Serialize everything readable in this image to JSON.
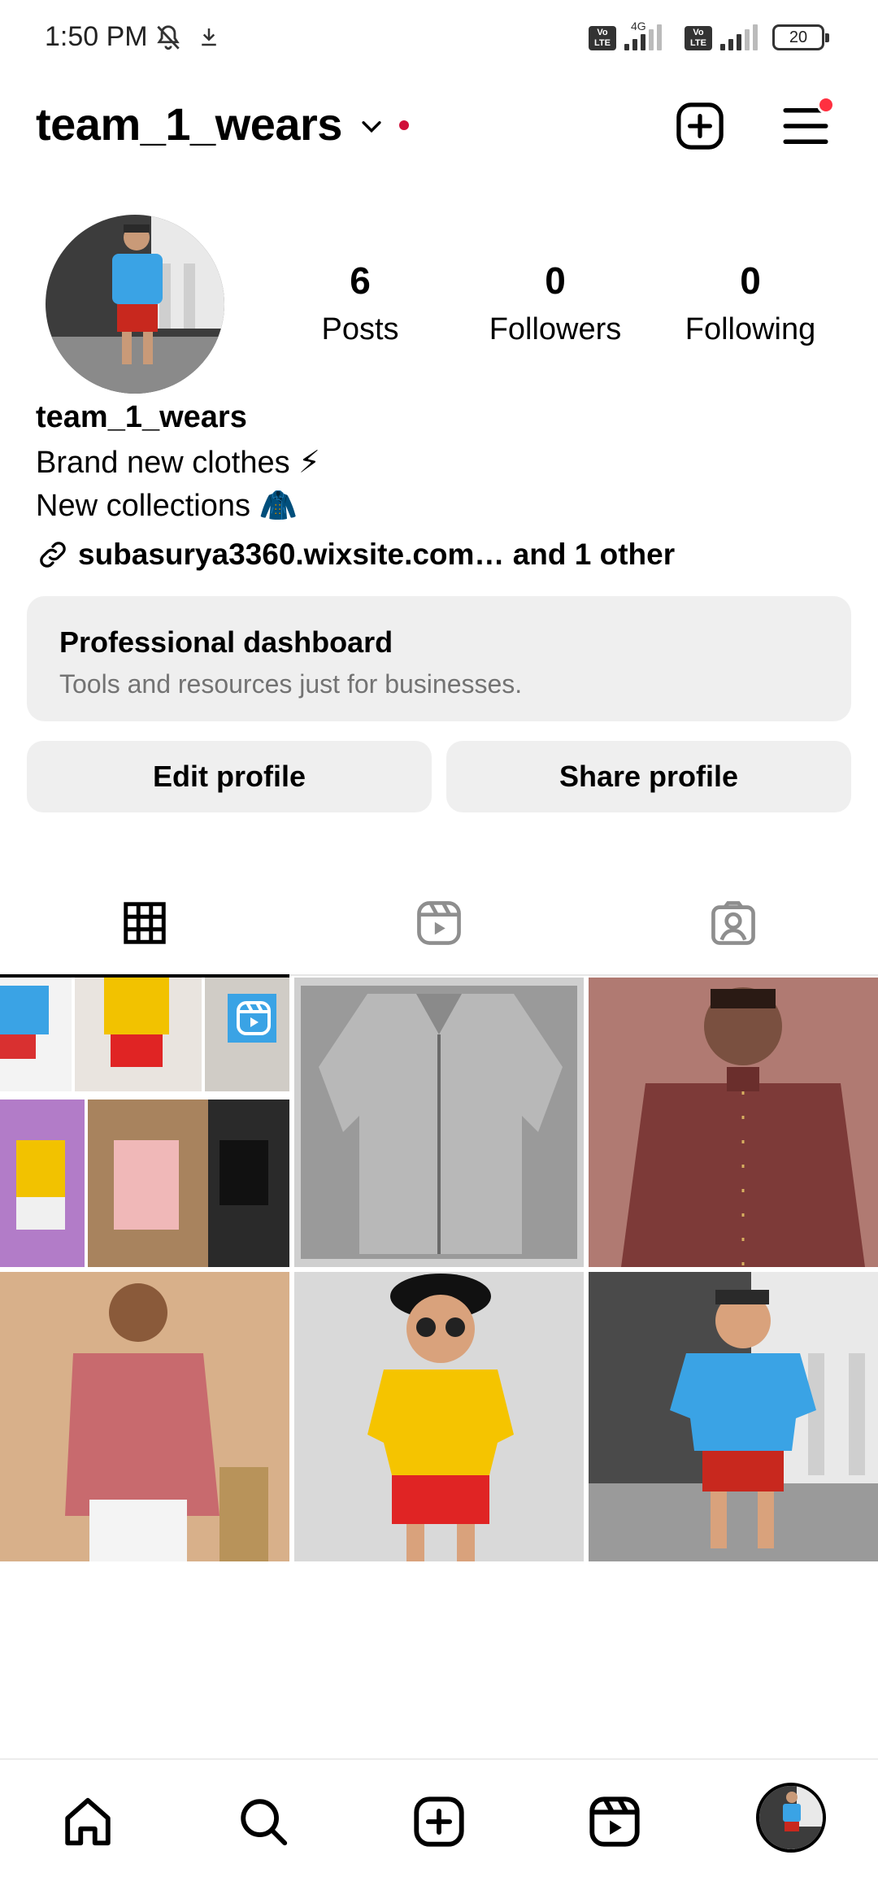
{
  "status_bar": {
    "time": "1:50 PM",
    "network_label": "4G",
    "volte_label": "Vo LTE",
    "battery": "20"
  },
  "header": {
    "username": "team_1_wears"
  },
  "profile": {
    "stats": [
      {
        "value": "6",
        "label": "Posts"
      },
      {
        "value": "0",
        "label": "Followers"
      },
      {
        "value": "0",
        "label": "Following"
      }
    ],
    "display_name": "team_1_wears",
    "bio_lines": [
      "Brand new clothes ⚡",
      "New collections 🧥"
    ],
    "link": "subasurya3360.wixsite.com… and 1 other"
  },
  "dashboard": {
    "title": "Professional dashboard",
    "subtitle": "Tools and resources just for businesses."
  },
  "buttons": {
    "edit_profile": "Edit profile",
    "share_profile": "Share profile"
  },
  "tabs": [
    "grid-tab",
    "reels-tab",
    "tagged-tab"
  ],
  "posts": [
    {
      "type": "collage-reel",
      "colors": [
        "#3a9fe0",
        "#f2c200",
        "#d93030"
      ]
    },
    {
      "type": "photo",
      "subject": "grey printed shirt",
      "colors": [
        "#9a9a9a",
        "#6a6a6a"
      ]
    },
    {
      "type": "photo",
      "subject": "maroon jodhpuri suit",
      "colors": [
        "#b07a72",
        "#7d3a38"
      ]
    },
    {
      "type": "photo",
      "subject": "pink jodhpuri suit",
      "colors": [
        "#d8b08a",
        "#c86a6e"
      ]
    },
    {
      "type": "photo",
      "subject": "kid yellow tshirt red shorts",
      "colors": [
        "#d9d9d9",
        "#f5c400",
        "#e02424"
      ]
    },
    {
      "type": "photo",
      "subject": "kid blue tshirt red shorts",
      "colors": [
        "#4a4a4a",
        "#3aa3e5",
        "#c8281e"
      ]
    }
  ],
  "bottom_nav": [
    "home-icon",
    "search-icon",
    "create-icon",
    "reels-icon",
    "profile-avatar"
  ]
}
